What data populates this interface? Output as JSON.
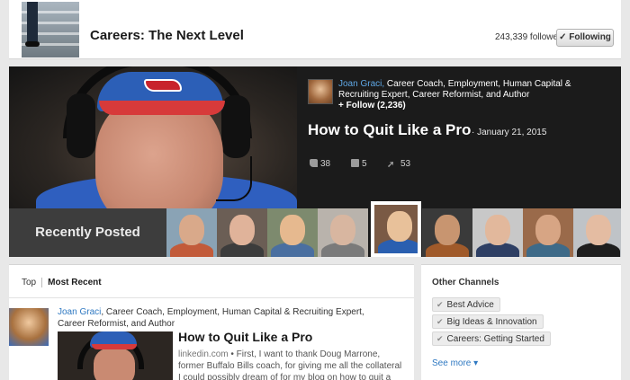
{
  "channel": {
    "title": "Careers: The Next Level",
    "followers": "243,339 followers",
    "following_label": "✓ Following"
  },
  "hero": {
    "author_name": "Joan Graci,",
    "author_headline": " Career Coach, Employment, Human Capital & Recruiting Expert, Career Reformist, and Author",
    "follow_label": "+ Follow (2,236)",
    "article_title": "How to Quit Like a Pro",
    "date": "· January 21, 2015",
    "likes": "38",
    "comments": "5",
    "shares": "53"
  },
  "recent": {
    "label": "Recently Posted",
    "thumbs": [
      {
        "skin": "#d9a98a",
        "shirt": "#c25b3a",
        "bg": "#8aa3b5"
      },
      {
        "skin": "#e0b39a",
        "shirt": "#3c3c3c",
        "bg": "#6b5e55"
      },
      {
        "skin": "#e6b98f",
        "shirt": "#4a6fa0",
        "bg": "#7d8a6e"
      },
      {
        "skin": "#d8b6a0",
        "shirt": "#7a7a7a",
        "bg": "#b9b3ac"
      },
      {
        "skin": "#e8c19a",
        "shirt": "#2a5fb0",
        "bg": "#7a5a45"
      },
      {
        "skin": "#c89570",
        "shirt": "#a05a2a",
        "bg": "#3a3a3a"
      },
      {
        "skin": "#e2b89c",
        "shirt": "#2e3f64",
        "bg": "#c8c8c8"
      },
      {
        "skin": "#d7a584",
        "shirt": "#3e6a88",
        "bg": "#9a6a4a"
      },
      {
        "skin": "#e4bca2",
        "shirt": "#1e1e1e",
        "bg": "#bfc3c7"
      }
    ]
  },
  "feed": {
    "tabs": [
      "Top",
      "Most Recent"
    ],
    "author_name": "Joan Graci",
    "author_headline": ", Career Coach, Employment, Human Capital & Recruiting Expert, Career Reformist, and Author",
    "article_title": "How to Quit Like a Pro",
    "source": "linkedin.com",
    "snippet": " • First, I want to thank Doug Marrone, former Buffalo Bills coach, for giving me all the collateral I could possibly dream of for my blog on how to quit a job in the..."
  },
  "other_channels": {
    "title": "Other Channels",
    "items": [
      "Best Advice",
      "Big Ideas & Innovation",
      "Careers: Getting Started"
    ],
    "see_more": "See more ▾"
  }
}
